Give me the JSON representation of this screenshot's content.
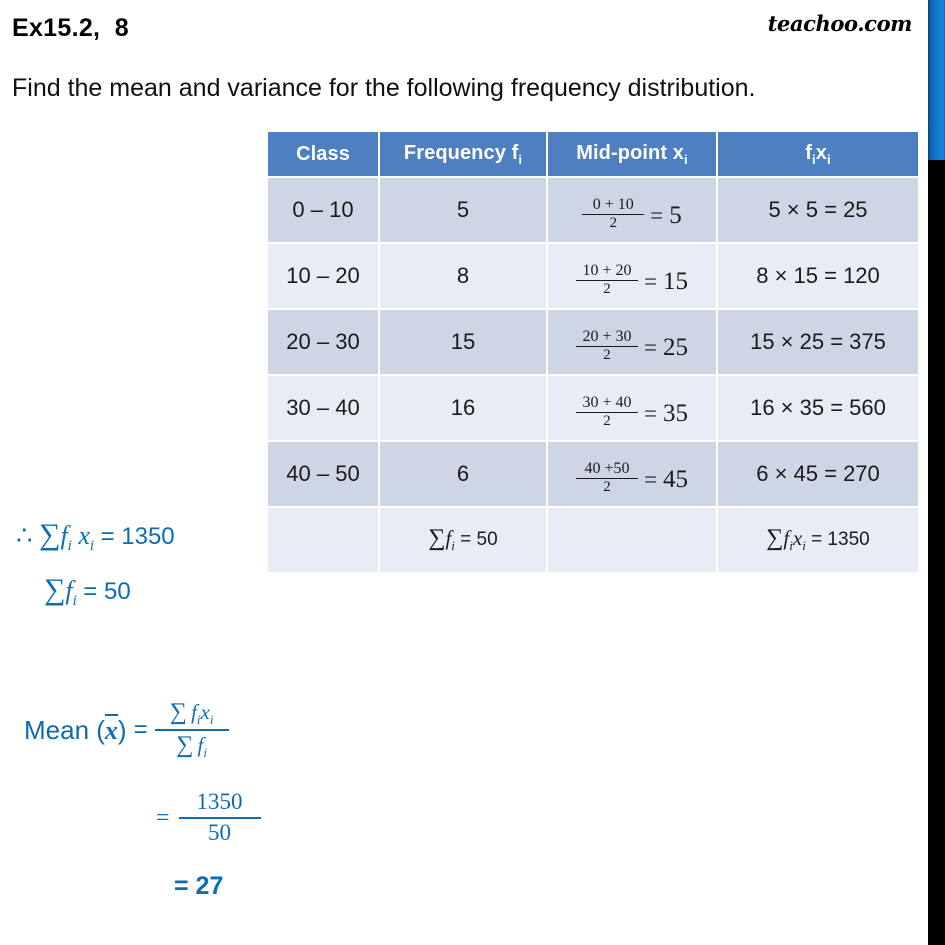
{
  "header": {
    "exercise_title": "Ex15.2,  8",
    "brand": "teachoo.com",
    "question": "Find the mean and variance for the following frequency distribution."
  },
  "table": {
    "columns": [
      {
        "key": "class",
        "label": "Class"
      },
      {
        "key": "frequency",
        "label": "Frequency f"
      },
      {
        "key": "midpoint",
        "label": "Mid-point x"
      },
      {
        "key": "fx",
        "label": "f"
      }
    ],
    "header_subscripts": {
      "frequency_sub": "i",
      "midpoint_sub": "i",
      "fx_first": "f",
      "fx_first_sub": "i",
      "fx_second": "x",
      "fx_second_sub": "i"
    },
    "rows": [
      {
        "class": "0 – 10",
        "frequency": "5",
        "mid_num": "0 + 10",
        "mid_den": "2",
        "mid_eq": "=",
        "mid_value": "5",
        "fx": "5 × 5 = 25"
      },
      {
        "class": "10 – 20",
        "frequency": "8",
        "mid_num": "10 + 20",
        "mid_den": "2",
        "mid_eq": "=",
        "mid_value": "15",
        "fx": "8 × 15 = 120"
      },
      {
        "class": "20 – 30",
        "frequency": "15",
        "mid_num": "20 + 30",
        "mid_den": "2",
        "mid_eq": "=",
        "mid_value": "25",
        "fx": "15 × 25 = 375"
      },
      {
        "class": "30 – 40",
        "frequency": "16",
        "mid_num": "30 + 40",
        "mid_den": "2",
        "mid_eq": "=",
        "mid_value": "35",
        "fx": "16 × 35 = 560"
      },
      {
        "class": "40 – 50",
        "frequency": "6",
        "mid_num": "40 +50",
        "mid_den": "2",
        "mid_eq": "=",
        "mid_value": "45",
        "fx": "6 × 45 = 270"
      }
    ],
    "totals": {
      "sum_f_sigma": "∑",
      "sum_f_var": "f",
      "sum_f_sub": "i",
      "sum_f_eq": "= 50",
      "sum_fx_sigma": "∑",
      "sum_fx_var1": "f",
      "sum_fx_sub1": "i",
      "sum_fx_var2": "x",
      "sum_fx_sub2": "i",
      "sum_fx_eq": "= 1350"
    }
  },
  "annotations": {
    "therefore": "∴",
    "sigma": "∑",
    "f": "f",
    "x": "x",
    "sub_i": "i",
    "sum_fx_value": "=  1350",
    "sum_f_value": "= 50"
  },
  "mean": {
    "label_text": "Mean (",
    "xbar": "x",
    "label_close": ")",
    "equals": "=",
    "formula_num_sigma": "∑",
    "formula_num_f": "f",
    "formula_num_sub1": "i",
    "formula_num_x": "x",
    "formula_num_sub2": "i",
    "formula_den_sigma": "∑",
    "formula_den_f": "f",
    "formula_den_sub": "i",
    "equals2": "=",
    "numeric_num": "1350",
    "numeric_den": "50",
    "result": "= 27"
  },
  "colors": {
    "header_blue": "#4e7fc1",
    "row_dark": "#ced5e5",
    "row_light": "#e7ecf5",
    "accent_blue": "#0e6cb5",
    "strip_blue": "#1379cf",
    "strip_black": "#000000"
  }
}
